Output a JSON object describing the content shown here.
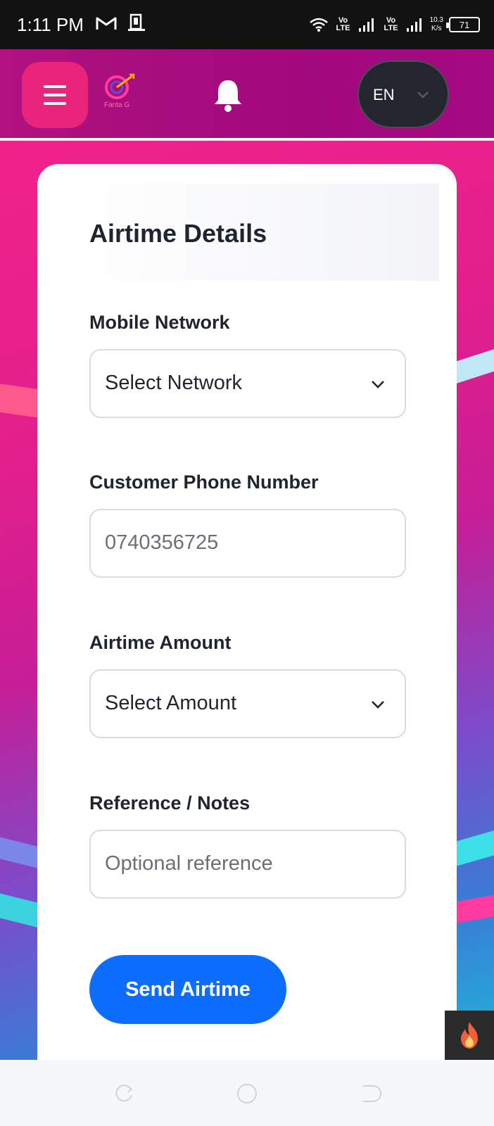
{
  "status_bar": {
    "time": "1:11 PM",
    "network_1": "Vo LTE",
    "network_2": "Vo LTE",
    "speed_value": "10.3",
    "speed_unit": "K/s",
    "battery": "71",
    "icons": [
      "gmail-icon",
      "sim-icon",
      "wifi-icon",
      "signal-icon",
      "battery-icon"
    ]
  },
  "header": {
    "menu_icon": "hamburger-icon",
    "logo_text": "Fanta G",
    "bell_icon": "bell-icon",
    "language": "EN"
  },
  "form": {
    "title": "Airtime Details",
    "network": {
      "label": "Mobile Network",
      "value": "Select Network"
    },
    "phone": {
      "label": "Customer Phone Number",
      "value": "0740356725"
    },
    "amount": {
      "label": "Airtime Amount",
      "value": "Select Amount"
    },
    "reference": {
      "label": "Reference / Notes",
      "placeholder": "Optional reference"
    },
    "submit_label": "Send Airtime"
  },
  "colors": {
    "accent": "#0d6efd",
    "header": "#a1097d",
    "menu_button": "#e8247b"
  }
}
